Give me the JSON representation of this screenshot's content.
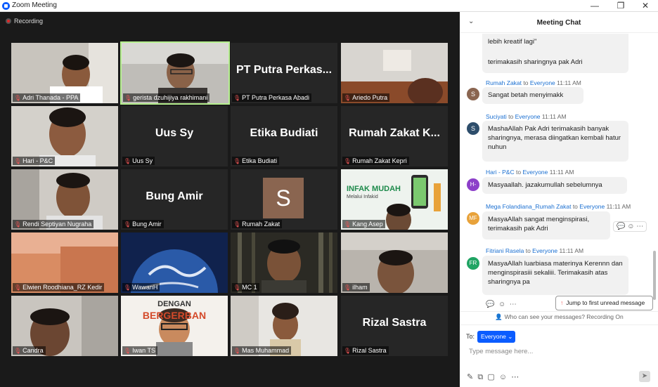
{
  "window": {
    "title": "Zoom Meeting"
  },
  "recording": "Recording",
  "tiles": [
    {
      "name": "Adri Thanada - PPA",
      "big": ""
    },
    {
      "name": "gerista dzuhijiya rakhimani",
      "big": ""
    },
    {
      "name": "PT Putra Perkasa Abadi",
      "big": "PT Putra Perkas..."
    },
    {
      "name": "Ariedo Putra",
      "big": ""
    },
    {
      "name": "Hari - P&C",
      "big": ""
    },
    {
      "name": "Uus Sy",
      "big": "Uus Sy"
    },
    {
      "name": "Etika Budiati",
      "big": "Etika Budiati"
    },
    {
      "name": "Rumah Zakat Kepri",
      "big": "Rumah Zakat K..."
    },
    {
      "name": "Rendi Septiyan Nugraha",
      "big": ""
    },
    {
      "name": "Bung Amir",
      "big": "Bung Amir"
    },
    {
      "name": "Rumah Zakat",
      "big": "",
      "avatar_letter": "S"
    },
    {
      "name": "Kang Asep",
      "big": "",
      "banner_title": "INFAK MUDAH",
      "banner_sub": "Melalui Infakid"
    },
    {
      "name": "Elwien Roodhiana_RZ Kedir",
      "big": ""
    },
    {
      "name": "WawanH",
      "big": ""
    },
    {
      "name": "MC 1",
      "big": ""
    },
    {
      "name": "ilham",
      "big": ""
    },
    {
      "name": "Candra",
      "big": ""
    },
    {
      "name": "Iwan TS",
      "big": "",
      "banner_title": "DENGAN",
      "banner_sub": "BERGERBAN"
    },
    {
      "name": "Mas Muhammad",
      "big": ""
    },
    {
      "name": "Rizal Sastra",
      "big": "Rizal Sastra"
    }
  ],
  "chat": {
    "title": "Meeting Chat",
    "top_partial": {
      "line1": "lebih kreatif lagi\"",
      "line2": "terimakasih sharingnya pak Adri"
    },
    "to_word": "to",
    "messages": [
      {
        "initials": "S",
        "color": "#8a6550",
        "from": "Rumah Zakat",
        "to": "Everyone",
        "time": "11:11 AM",
        "text": "Sangat betah menyimakk"
      },
      {
        "initials": "S",
        "color": "#2d4d6b",
        "from": "Suciyati",
        "to": "Everyone",
        "time": "11:11 AM",
        "text": "MashaAllah Pak Adri terimakasih banyak sharingnya, merasa diingatkan kembali hatur nuhun"
      },
      {
        "initials": "H-",
        "color": "#8c3fc9",
        "from": "Hari - P&C",
        "to": "Everyone",
        "time": "11:11 AM",
        "text": "Masyaallah. jazakumullah sebelumnya"
      },
      {
        "initials": "MF",
        "color": "#e8a23a",
        "from": "Mega Folandiana_Rumah Zakat",
        "to": "Everyone",
        "time": "11:11 AM",
        "text": "MasyaAllah sangat menginspirasi, terimakasih pak Adri"
      },
      {
        "initials": "FR",
        "color": "#21a464",
        "from": "Fitriani Rasela",
        "to": "Everyone",
        "time": "11:11 AM",
        "text": "MasyaAllah luarbiasa materinya Kerennn dan menginspirasiii sekaliii. Terimakasih atas sharingnya pa"
      }
    ],
    "jump_label": "Jump to first unread message",
    "visibility_note": "Who can see your messages? Recording On",
    "to_label": "To:",
    "recipient": "Everyone",
    "input_placeholder": "Type message here..."
  }
}
